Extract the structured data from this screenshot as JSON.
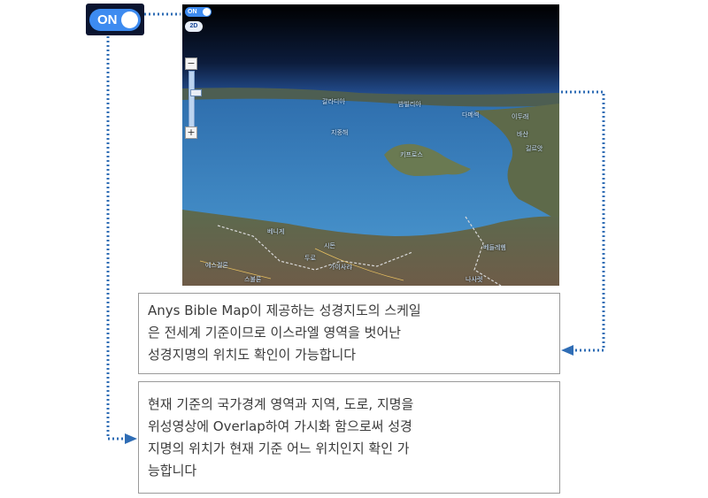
{
  "toggle": {
    "label": "ON",
    "state": "on",
    "color": "#3d8bf0"
  },
  "map_view": {
    "mini_toggle_label": "ON",
    "mode_button_label": "2D",
    "zoom_minus": "−",
    "zoom_plus": "+",
    "labels": {
      "sea": "지중해",
      "north": "키프로스",
      "coast_1": "베니게",
      "coast_2": "시돈",
      "coast_3": "두로",
      "coast_4": "가이사랴",
      "coast_5": "에스겔론",
      "coast_6": "스불론",
      "coast_7": "베들레헴",
      "coast_8": "나사렛",
      "east_1": "다메섹",
      "east_2": "이두래",
      "east_3": "바산",
      "east_4": "길르앗",
      "west_1": "갈라디아",
      "west_2": "밤빌리아"
    }
  },
  "callouts": {
    "first": {
      "line1": "Anys Bible Map이 제공하는 성경지도의 스케일",
      "line2": "은 전세계 기준이므로 이스라엘 영역을 벗어난",
      "line3": "성경지명의 위치도 확인이 가능합니다"
    },
    "second": {
      "line1": "현재 기준의 국가경계 영역과 지역, 도로, 지명을",
      "line2": "위성영상에 Overlap하여 가시화 함으로써 성경",
      "line3": "지명의 위치가 현재 기준 어느 위치인지 확인 가",
      "line4": "능합니다"
    }
  },
  "colors": {
    "connector": "#2f6db5",
    "sea": "#3b86c6",
    "land": "#6b6a4a",
    "sky_top": "#000000",
    "sky_bottom": "#2a5aa8"
  }
}
